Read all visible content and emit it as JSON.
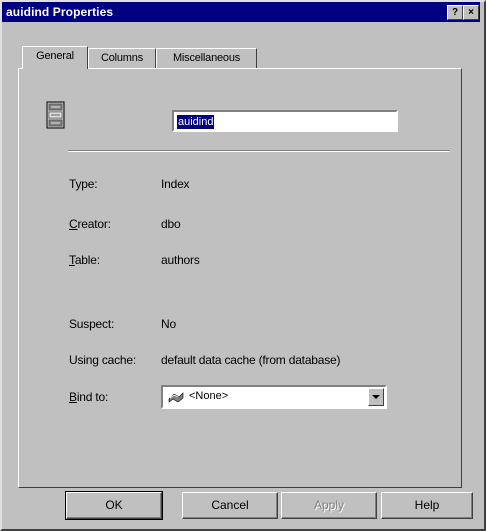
{
  "window": {
    "title": "auidind Properties",
    "help_glyph": "?",
    "close_glyph": "×"
  },
  "tabs": [
    {
      "label": "General",
      "active": true
    },
    {
      "label": "Columns",
      "active": false
    },
    {
      "label": "Miscellaneous",
      "active": false
    }
  ],
  "general": {
    "icon": "index-icon",
    "name_value": "auidind",
    "fields": {
      "type": {
        "label": "Type:",
        "value": "Index"
      },
      "creator": {
        "label_underline": "C",
        "label_rest": "reator:",
        "value": "dbo"
      },
      "table": {
        "label_underline": "T",
        "label_rest": "able:",
        "value": "authors"
      },
      "suspect": {
        "label": "Suspect:",
        "value": "No"
      },
      "using_cache": {
        "label": "Using cache:",
        "value": "default data cache (from database)"
      }
    },
    "bind_to": {
      "label_underline": "B",
      "label_rest": "ind to:",
      "selected": "<None>",
      "icon": "cache-icon"
    }
  },
  "buttons": {
    "ok": "OK",
    "cancel": "Cancel",
    "apply": "Apply",
    "help": "Help"
  }
}
